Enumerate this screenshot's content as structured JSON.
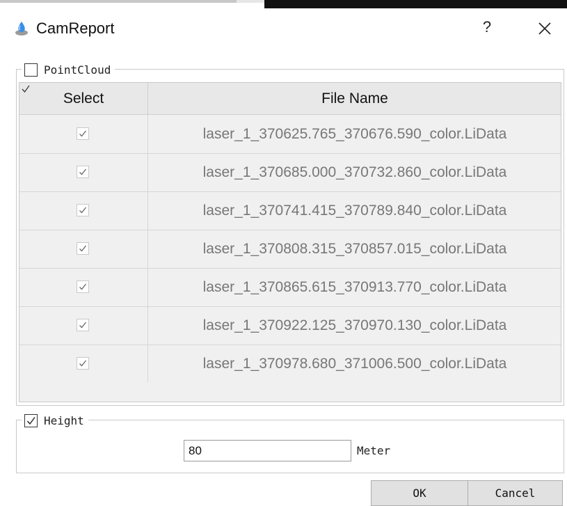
{
  "window": {
    "title": "CamReport",
    "help_label": "?",
    "icon": "app-drop-icon"
  },
  "pointcloud": {
    "label": "PointCloud",
    "checked": false,
    "table": {
      "header_select": "Select",
      "header_file": "File Name",
      "rows": [
        {
          "checked": true,
          "file": "laser_1_370625.765_370676.590_color.LiData"
        },
        {
          "checked": true,
          "file": "laser_1_370685.000_370732.860_color.LiData"
        },
        {
          "checked": true,
          "file": "laser_1_370741.415_370789.840_color.LiData"
        },
        {
          "checked": true,
          "file": "laser_1_370808.315_370857.015_color.LiData"
        },
        {
          "checked": true,
          "file": "laser_1_370865.615_370913.770_color.LiData"
        },
        {
          "checked": true,
          "file": "laser_1_370922.125_370970.130_color.LiData"
        },
        {
          "checked": true,
          "file": "laser_1_370978.680_371006.500_color.LiData"
        }
      ]
    }
  },
  "height": {
    "label": "Height",
    "checked": true,
    "value": "80",
    "unit": "Meter"
  },
  "buttons": {
    "ok": "OK",
    "cancel": "Cancel"
  },
  "colors": {
    "accent_drop": "#3a8ee6",
    "row_text": "#777777",
    "table_bg": "#f0f0f0"
  }
}
